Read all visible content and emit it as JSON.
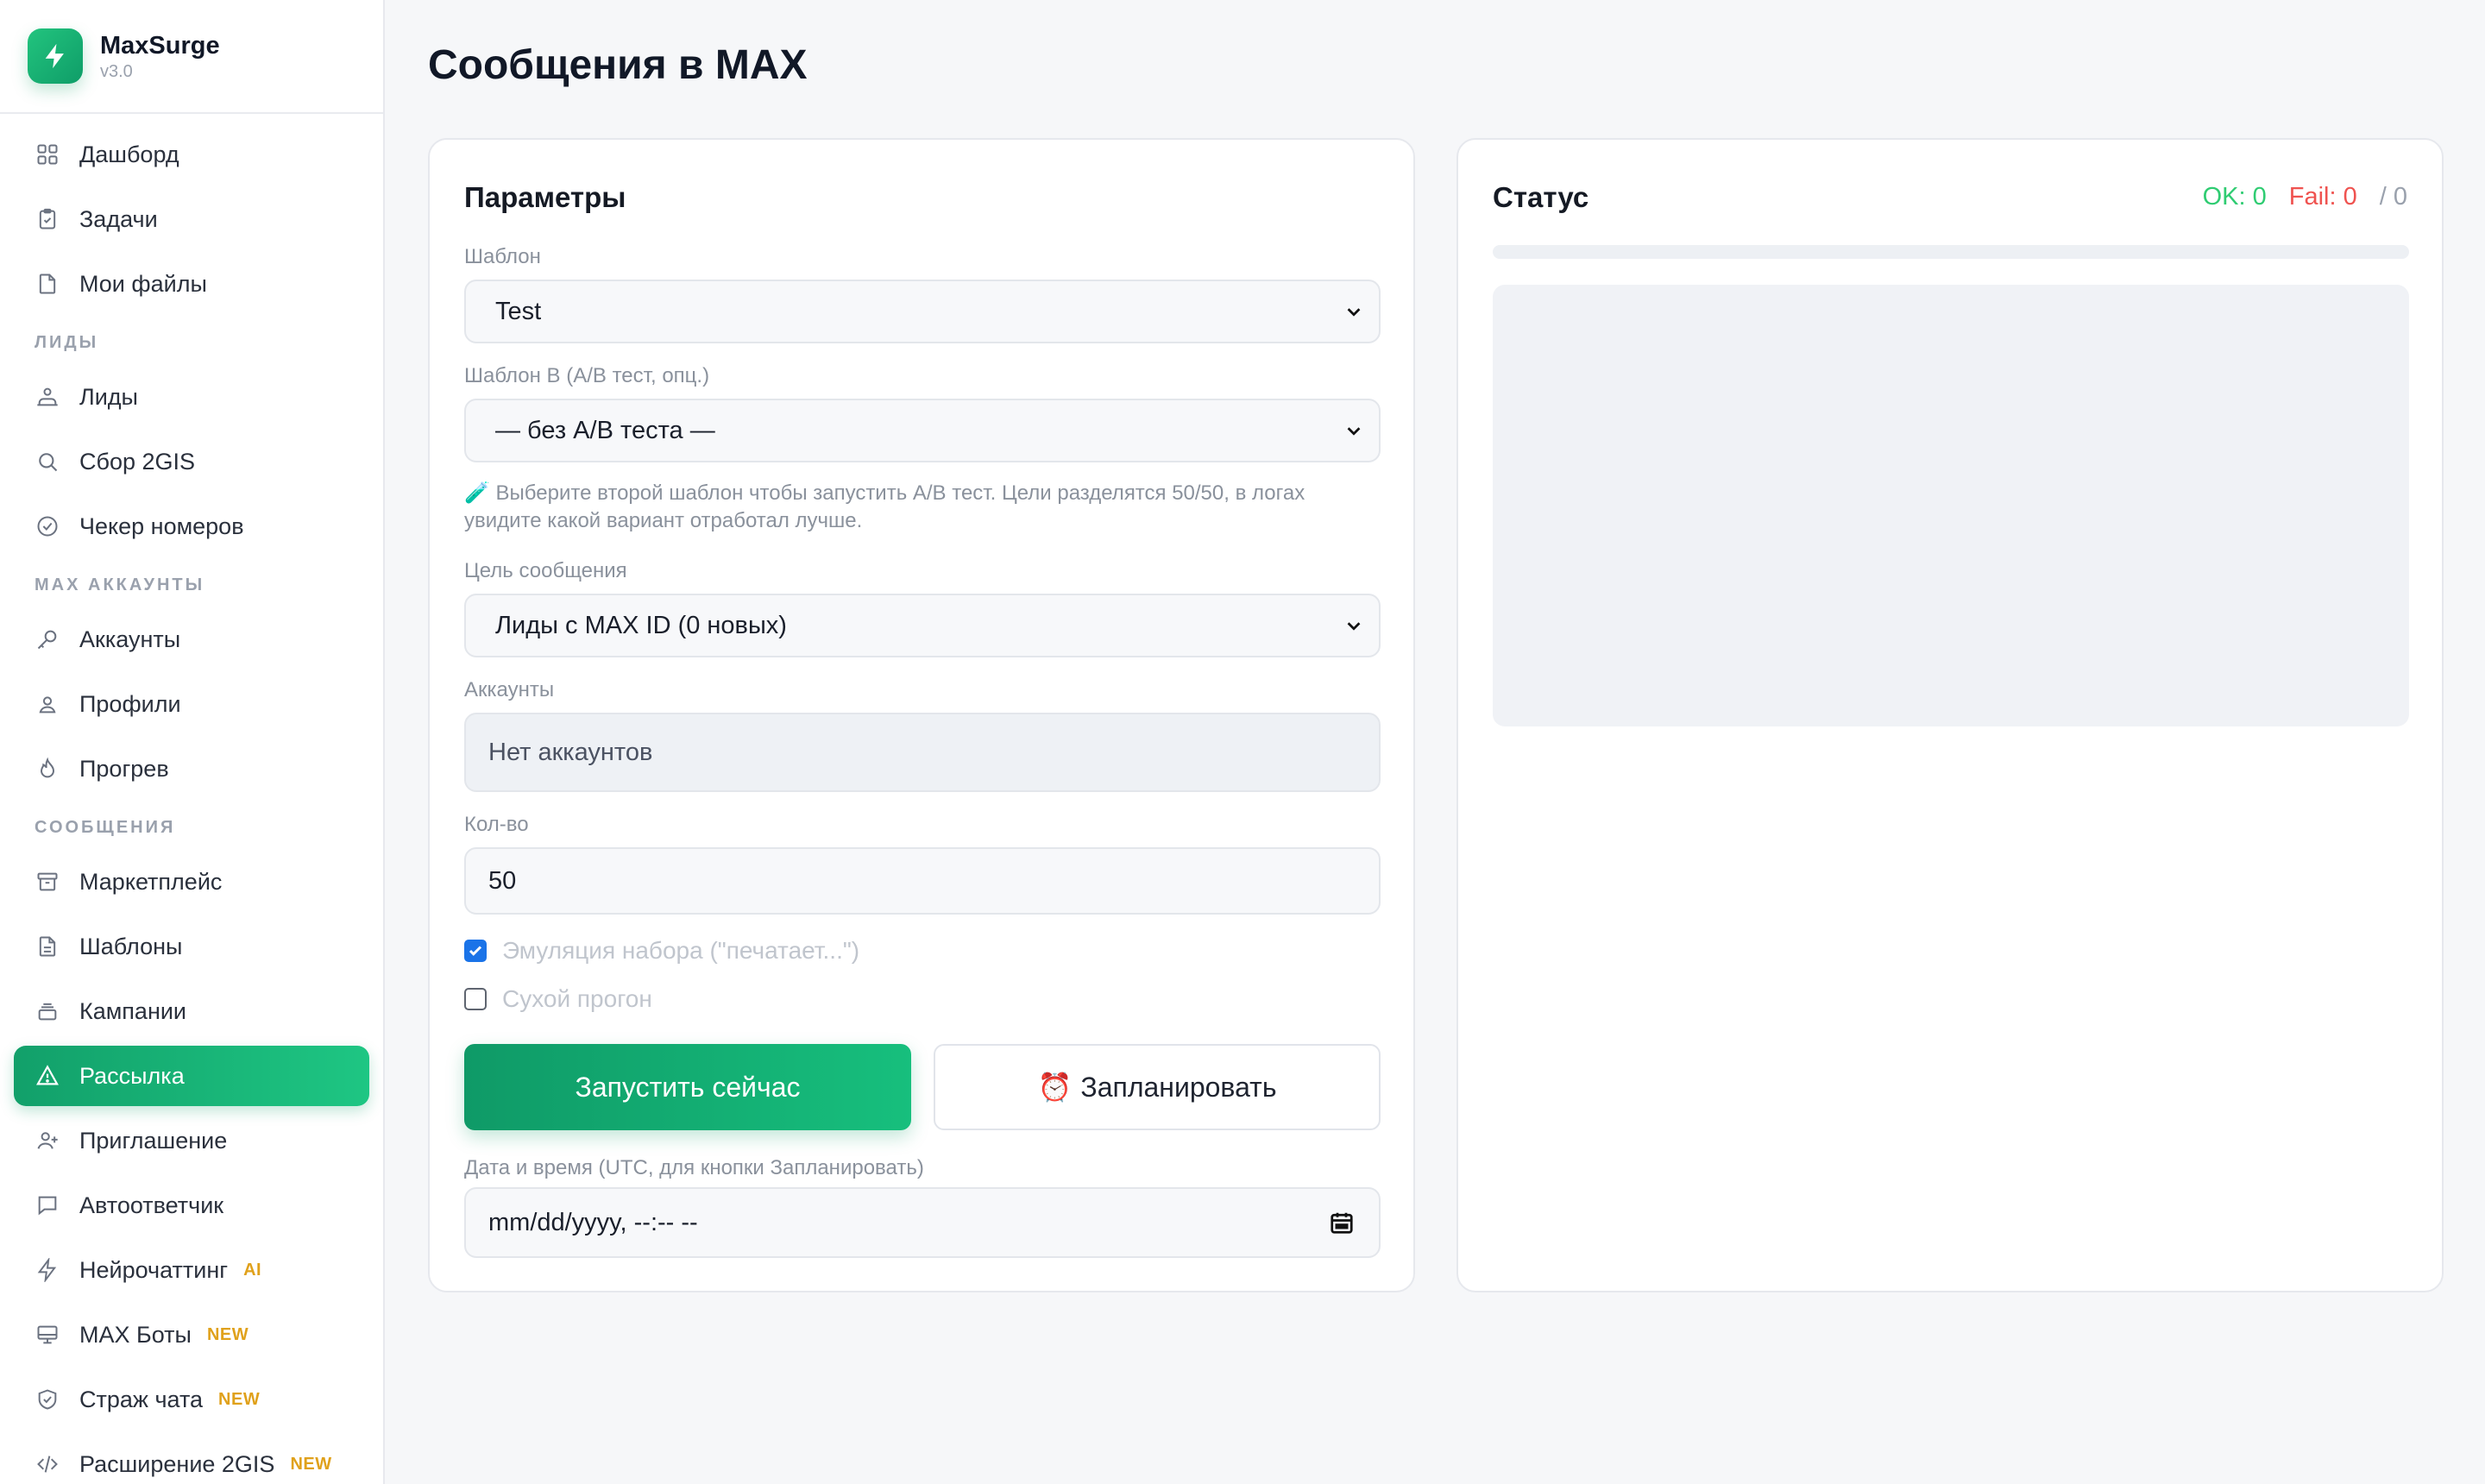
{
  "brand": {
    "name": "MaxSurge",
    "version": "v3.0"
  },
  "sidebar": {
    "items": [
      {
        "label": "Дашборд"
      },
      {
        "label": "Задачи"
      },
      {
        "label": "Мои файлы"
      },
      {
        "section": "ЛИДЫ"
      },
      {
        "label": "Лиды"
      },
      {
        "label": "Сбор 2GIS"
      },
      {
        "label": "Чекер номеров"
      },
      {
        "section": "MAX АККАУНТЫ"
      },
      {
        "label": "Аккаунты"
      },
      {
        "label": "Профили"
      },
      {
        "label": "Прогрев"
      },
      {
        "section": "СООБЩЕНИЯ"
      },
      {
        "label": "Маркетплейс"
      },
      {
        "label": "Шаблоны"
      },
      {
        "label": "Кампании"
      },
      {
        "label": "Рассылка",
        "active": true
      },
      {
        "label": "Приглашение"
      },
      {
        "label": "Автоответчик"
      },
      {
        "label": "Нейрочаттинг",
        "badge": "AI"
      },
      {
        "label": "MAX Боты",
        "badge": "NEW"
      },
      {
        "label": "Страж чата",
        "badge": "NEW"
      },
      {
        "label": "Расширение 2GIS",
        "badge": "NEW"
      }
    ]
  },
  "page": {
    "title": "Сообщения в MAX"
  },
  "params": {
    "title": "Параметры",
    "template_label": "Шаблон",
    "template_value": "Test",
    "template_b_label": "Шаблон B (A/B тест, опц.)",
    "template_b_value": "— без A/B теста —",
    "ab_hint": "🧪 Выберите второй шаблон чтобы запустить A/B тест. Цели разделятся 50/50, в логах увидите какой вариант отработал лучше.",
    "target_label": "Цель сообщения",
    "target_value": "Лиды с MAX ID (0 новых)",
    "accounts_label": "Аккаунты",
    "accounts_value": "Нет аккаунтов",
    "qty_label": "Кол-во",
    "qty_value": "50",
    "typing_label": "Эмуляция набора (\"печатает...\")",
    "typing_checked": true,
    "dry_run_label": "Сухой прогон",
    "dry_run_checked": false,
    "run_button": "Запустить сейчас",
    "schedule_button": "Запланировать",
    "schedule_emoji": "⏰",
    "datetime_label": "Дата и время (UTC, для кнопки Запланировать)",
    "datetime_placeholder": "mm/dd/yyyy, --:-- --"
  },
  "status": {
    "title": "Статус",
    "ok": "OK: 0",
    "fail": "Fail: 0",
    "total": "/ 0",
    "progress": 0
  },
  "colors": {
    "accent": "#12a06a",
    "ok": "#2fcc72",
    "fail": "#ef5350",
    "badge": "#e0a11b"
  }
}
